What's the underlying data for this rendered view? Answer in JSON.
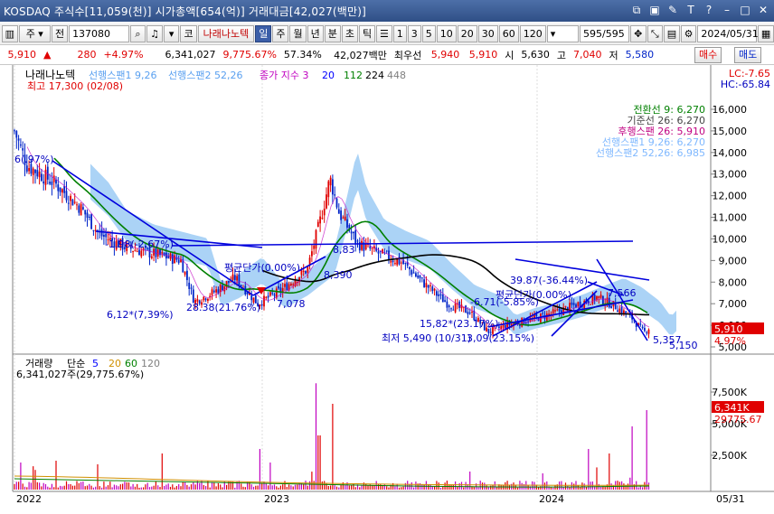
{
  "titlebar": {
    "title": "KOSDAQ 주식수[11,059(천)] 시가총액[654(억)] 거래대금[42,027(백만)]",
    "icons": [
      "restore-icon",
      "layout-icon",
      "pin-icon",
      "text-icon",
      "help-icon",
      "minimize-icon",
      "maximize-icon",
      "close-icon"
    ]
  },
  "toolbar": {
    "type_select": "주",
    "prev_label": "전",
    "code_value": "137080",
    "stock_btn": "코",
    "stock_name": "나래나노텍",
    "periods": [
      "일",
      "주",
      "월",
      "년",
      "분",
      "초",
      "틱"
    ],
    "active_period": "일",
    "intervals": [
      "1",
      "3",
      "5",
      "10",
      "20",
      "30",
      "60",
      "120"
    ],
    "count_value": "595/595",
    "date_value": "2024/05/31"
  },
  "quote": {
    "price": "5,910",
    "change": "280",
    "change_pct": "+4.97%",
    "volume": "6,341,027",
    "volume_pct": "9,775.67%",
    "turnover_pct": "57.34%",
    "trade_value": "42,027백만",
    "best_label": "최우선",
    "ask": "5,940",
    "bid": "5,910",
    "open_label": "시",
    "open": "5,630",
    "high_label": "고",
    "high": "7,040",
    "low_label": "저",
    "low": "5,580",
    "buy_label": "매수",
    "sell_label": "매도"
  },
  "chart": {
    "legend_name": "나래나노텍",
    "legend_span1": "선행스팬1 9,26",
    "legend_span2": "선행스팬2 52,26",
    "legend_ma": "종가 지수 3",
    "legend_ma_values": [
      "20",
      "112",
      "224",
      "448"
    ],
    "highest_label": "최고 17,300 (02/08)",
    "lowest_label": "최저 5,490 (10/31)",
    "lc_label": "LC:-7.65",
    "hc_label": "HC:-65.84",
    "ichimoku": [
      {
        "label": "전환선 9: 6,270",
        "color": "#008000"
      },
      {
        "label": "기준선 26: 6,270",
        "color": "#444444"
      },
      {
        "label": "후행스팬 26: 5,910",
        "color": "#c00080"
      },
      {
        "label": "선행스팬1 9,26: 6,270",
        "color": "#7fb8ff"
      },
      {
        "label": "선행스팬2 52,26: 6,985",
        "color": "#7fb8ff"
      }
    ],
    "price_ticks": [
      "16,000",
      "15,000",
      "14,000",
      "13,000",
      "12,000",
      "11,000",
      "10,000",
      "9,000",
      "8,000",
      "7,000",
      "6,000",
      "5,000"
    ],
    "current_price_tag": "5,910",
    "current_pct_tag": "4.97%",
    "annotations": [
      {
        "text": "6(.97%)"
      },
      {
        "text": "-1.98(-2.67%)"
      },
      {
        "text": "6,12*(7,39%)"
      },
      {
        "text": "28.38(21.76%)"
      },
      {
        "text": "평균단가(0.00%)"
      },
      {
        "text": "7,078"
      },
      {
        "text": "8,390"
      },
      {
        "text": "8,83"
      },
      {
        "text": "39.87(-36.44%)"
      },
      {
        "text": "평균단가(0.00%)"
      },
      {
        "text": "7,566"
      },
      {
        "text": "-6.71(-5.85%)"
      },
      {
        "text": "15,82*(23.17%)"
      },
      {
        "text": "3,09(23.15%)"
      },
      {
        "text": "5,357"
      },
      {
        "text": "5,150"
      }
    ],
    "volume_legend": {
      "name": "거래량",
      "type": "단순",
      "ma": [
        "5",
        "20",
        "60",
        "120"
      ],
      "value_line": "6,341,027주(29,775.67%)"
    },
    "volume_ticks": [
      "7,500K",
      "5,000K",
      "2,500K"
    ],
    "volume_tag": "6,341K",
    "volume_pct_tag": "29775.67",
    "x_labels": [
      "2022",
      "2023",
      "2024"
    ],
    "x_end_label": "05/31",
    "colors": {
      "up": "#e00000",
      "down": "#0024c8",
      "cloud": "#9ccbf5",
      "ma_black": "#000000",
      "ma_green": "#008000",
      "trend": "#0000dd"
    }
  }
}
